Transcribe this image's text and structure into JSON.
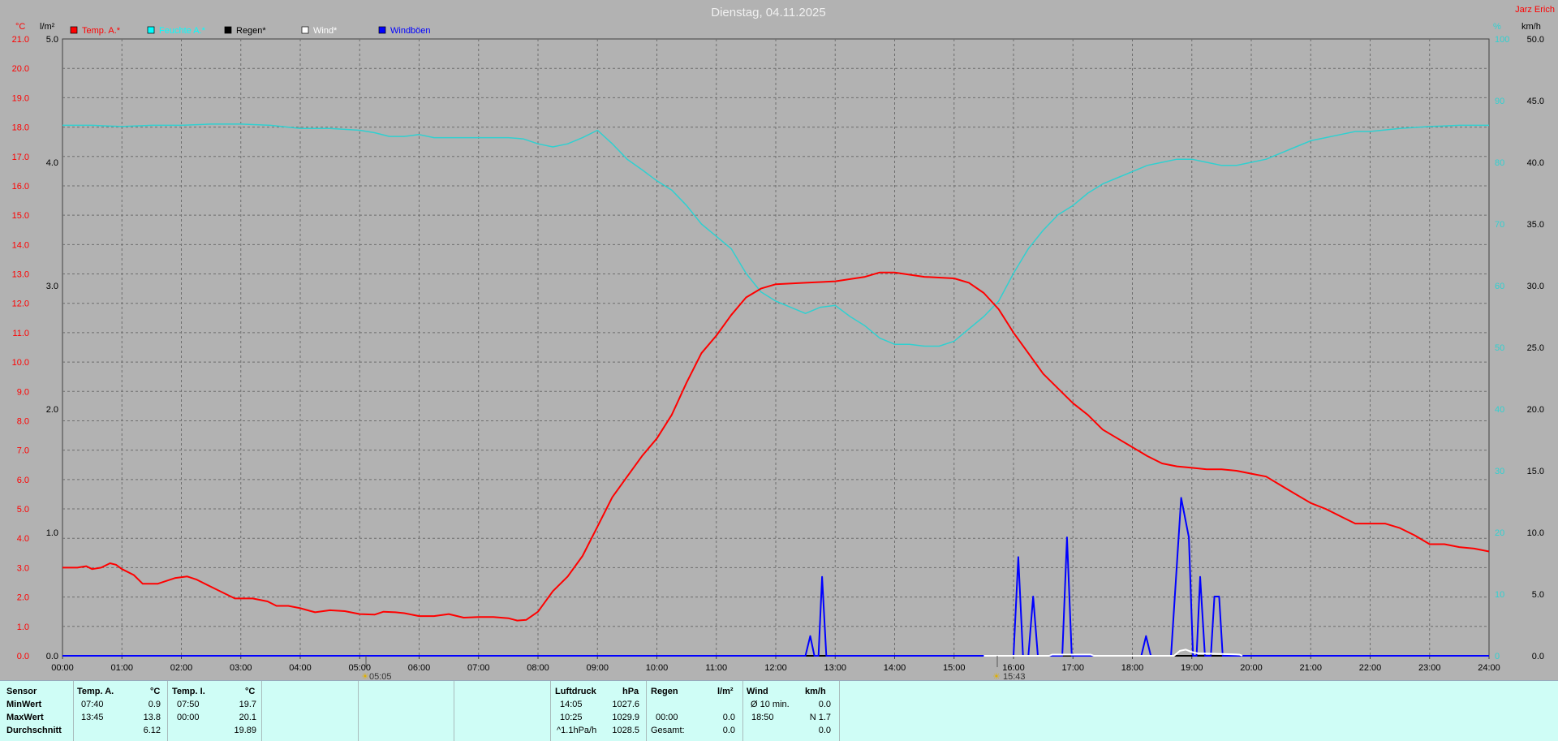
{
  "title": "Dienstag, 04.11.2025",
  "author": "Jarz Erich",
  "units": {
    "temp": "°C",
    "rain": "l/m²",
    "hum": "%",
    "wind": "km/h"
  },
  "legend": [
    {
      "label": "Temp. A.*",
      "color": "#ff0000"
    },
    {
      "label": "Feuchte A.*",
      "color": "#00ffff"
    },
    {
      "label": "Regen*",
      "color": "#000000"
    },
    {
      "label": "Wind*",
      "color": "#ffffff"
    },
    {
      "label": "Windböen",
      "color": "#0000ff"
    }
  ],
  "sun": {
    "rise": "05:05",
    "set": "15:43"
  },
  "chart_data": {
    "type": "line",
    "x_ticks": [
      "00:00",
      "01:00",
      "02:00",
      "03:00",
      "04:00",
      "05:00",
      "06:00",
      "07:00",
      "08:00",
      "09:00",
      "10:00",
      "11:00",
      "12:00",
      "13:00",
      "14:00",
      "15:00",
      "16:00",
      "17:00",
      "18:00",
      "19:00",
      "20:00",
      "21:00",
      "22:00",
      "23:00",
      "24:00"
    ],
    "temp_ticks": [
      "0.0",
      "1.0",
      "2.0",
      "3.0",
      "4.0",
      "5.0",
      "6.0",
      "7.0",
      "8.0",
      "9.0",
      "10.0",
      "11.0",
      "12.0",
      "13.0",
      "14.0",
      "15.0",
      "16.0",
      "17.0",
      "18.0",
      "19.0",
      "20.0",
      "21.0"
    ],
    "rain_ticks": [
      "0.0",
      "1.0",
      "2.0",
      "3.0",
      "4.0",
      "5.0"
    ],
    "hum_ticks": [
      "0",
      "10",
      "20",
      "30",
      "40",
      "50",
      "60",
      "70",
      "80",
      "90",
      "100"
    ],
    "wind_ticks": [
      "0.0",
      "5.0",
      "10.0",
      "15.0",
      "20.0",
      "25.0",
      "30.0",
      "35.0",
      "40.0",
      "45.0",
      "50.0"
    ],
    "ylim_temp": [
      0,
      21
    ],
    "ylim_rain": [
      0,
      5
    ],
    "ylim_hum": [
      0,
      100
    ],
    "ylim_wind": [
      0,
      50
    ],
    "grid": true,
    "series": [
      {
        "name": "Temp. A.*",
        "color": "#ff0000",
        "axis": "temp",
        "points": [
          [
            0,
            3.0
          ],
          [
            0.25,
            3.0
          ],
          [
            0.4,
            3.05
          ],
          [
            0.5,
            2.95
          ],
          [
            0.65,
            3.0
          ],
          [
            0.8,
            3.15
          ],
          [
            0.9,
            3.1
          ],
          [
            1.0,
            2.95
          ],
          [
            1.2,
            2.75
          ],
          [
            1.35,
            2.45
          ],
          [
            1.6,
            2.45
          ],
          [
            1.75,
            2.55
          ],
          [
            1.9,
            2.65
          ],
          [
            2.1,
            2.7
          ],
          [
            2.25,
            2.6
          ],
          [
            2.5,
            2.35
          ],
          [
            2.75,
            2.1
          ],
          [
            2.9,
            1.95
          ],
          [
            3.2,
            1.95
          ],
          [
            3.45,
            1.85
          ],
          [
            3.6,
            1.7
          ],
          [
            3.8,
            1.7
          ],
          [
            4.0,
            1.62
          ],
          [
            4.25,
            1.48
          ],
          [
            4.5,
            1.55
          ],
          [
            4.75,
            1.52
          ],
          [
            5.0,
            1.42
          ],
          [
            5.25,
            1.4
          ],
          [
            5.4,
            1.5
          ],
          [
            5.6,
            1.48
          ],
          [
            5.75,
            1.45
          ],
          [
            6.0,
            1.35
          ],
          [
            6.25,
            1.35
          ],
          [
            6.5,
            1.42
          ],
          [
            6.75,
            1.3
          ],
          [
            7.0,
            1.32
          ],
          [
            7.25,
            1.32
          ],
          [
            7.5,
            1.28
          ],
          [
            7.65,
            1.2
          ],
          [
            7.8,
            1.22
          ],
          [
            8.0,
            1.5
          ],
          [
            8.25,
            2.2
          ],
          [
            8.5,
            2.7
          ],
          [
            8.75,
            3.4
          ],
          [
            9.0,
            4.4
          ],
          [
            9.25,
            5.4
          ],
          [
            9.5,
            6.1
          ],
          [
            9.75,
            6.8
          ],
          [
            10.0,
            7.4
          ],
          [
            10.25,
            8.2
          ],
          [
            10.5,
            9.3
          ],
          [
            10.75,
            10.3
          ],
          [
            11.0,
            10.9
          ],
          [
            11.25,
            11.6
          ],
          [
            11.5,
            12.2
          ],
          [
            11.75,
            12.5
          ],
          [
            12.0,
            12.65
          ],
          [
            12.5,
            12.7
          ],
          [
            13.0,
            12.75
          ],
          [
            13.5,
            12.9
          ],
          [
            13.75,
            13.05
          ],
          [
            14.0,
            13.05
          ],
          [
            14.5,
            12.9
          ],
          [
            15.0,
            12.85
          ],
          [
            15.25,
            12.7
          ],
          [
            15.5,
            12.35
          ],
          [
            15.75,
            11.8
          ],
          [
            16.0,
            11.0
          ],
          [
            16.25,
            10.3
          ],
          [
            16.5,
            9.6
          ],
          [
            16.75,
            9.1
          ],
          [
            17.0,
            8.6
          ],
          [
            17.25,
            8.2
          ],
          [
            17.5,
            7.7
          ],
          [
            17.75,
            7.4
          ],
          [
            18.0,
            7.1
          ],
          [
            18.25,
            6.8
          ],
          [
            18.5,
            6.55
          ],
          [
            18.75,
            6.45
          ],
          [
            19.0,
            6.4
          ],
          [
            19.25,
            6.35
          ],
          [
            19.5,
            6.35
          ],
          [
            19.75,
            6.3
          ],
          [
            20.0,
            6.2
          ],
          [
            20.25,
            6.1
          ],
          [
            20.5,
            5.8
          ],
          [
            20.75,
            5.5
          ],
          [
            21.0,
            5.2
          ],
          [
            21.25,
            5.0
          ],
          [
            21.5,
            4.75
          ],
          [
            21.75,
            4.5
          ],
          [
            22.0,
            4.5
          ],
          [
            22.25,
            4.5
          ],
          [
            22.5,
            4.35
          ],
          [
            22.75,
            4.1
          ],
          [
            23.0,
            3.8
          ],
          [
            23.25,
            3.8
          ],
          [
            23.5,
            3.7
          ],
          [
            23.75,
            3.65
          ],
          [
            24.0,
            3.55
          ]
        ]
      },
      {
        "name": "Feuchte A.*",
        "color": "#30d0d0",
        "axis": "hum",
        "points": [
          [
            0,
            86.0
          ],
          [
            0.5,
            86.0
          ],
          [
            1.0,
            85.8
          ],
          [
            1.5,
            86.0
          ],
          [
            2.0,
            86.0
          ],
          [
            2.5,
            86.2
          ],
          [
            3.0,
            86.2
          ],
          [
            3.5,
            86.0
          ],
          [
            4.0,
            85.5
          ],
          [
            4.5,
            85.5
          ],
          [
            5.0,
            85.2
          ],
          [
            5.25,
            84.8
          ],
          [
            5.5,
            84.2
          ],
          [
            5.75,
            84.2
          ],
          [
            6.0,
            84.5
          ],
          [
            6.25,
            84.0
          ],
          [
            6.5,
            84.0
          ],
          [
            6.75,
            84.0
          ],
          [
            7.0,
            84.0
          ],
          [
            7.5,
            84.0
          ],
          [
            7.75,
            83.8
          ],
          [
            8.0,
            83.0
          ],
          [
            8.25,
            82.5
          ],
          [
            8.5,
            83.0
          ],
          [
            8.75,
            84.0
          ],
          [
            9.0,
            85.2
          ],
          [
            9.25,
            83.0
          ],
          [
            9.5,
            80.5
          ],
          [
            9.75,
            78.8
          ],
          [
            10.0,
            77.0
          ],
          [
            10.25,
            75.5
          ],
          [
            10.5,
            73.0
          ],
          [
            10.75,
            70.0
          ],
          [
            11.0,
            68.0
          ],
          [
            11.25,
            66.0
          ],
          [
            11.5,
            62.0
          ],
          [
            11.75,
            59.0
          ],
          [
            12.0,
            57.5
          ],
          [
            12.25,
            56.5
          ],
          [
            12.5,
            55.5
          ],
          [
            12.75,
            56.5
          ],
          [
            13.0,
            56.8
          ],
          [
            13.25,
            55.0
          ],
          [
            13.5,
            53.5
          ],
          [
            13.75,
            51.5
          ],
          [
            14.0,
            50.5
          ],
          [
            14.25,
            50.5
          ],
          [
            14.5,
            50.2
          ],
          [
            14.75,
            50.2
          ],
          [
            15.0,
            51.0
          ],
          [
            15.25,
            53.0
          ],
          [
            15.5,
            55.0
          ],
          [
            15.75,
            57.5
          ],
          [
            16.0,
            62.0
          ],
          [
            16.25,
            66.0
          ],
          [
            16.5,
            69.0
          ],
          [
            16.75,
            71.5
          ],
          [
            17.0,
            73.0
          ],
          [
            17.25,
            75.0
          ],
          [
            17.5,
            76.5
          ],
          [
            17.75,
            77.5
          ],
          [
            18.0,
            78.5
          ],
          [
            18.25,
            79.5
          ],
          [
            18.5,
            80.0
          ],
          [
            18.75,
            80.5
          ],
          [
            19.0,
            80.5
          ],
          [
            19.25,
            80.0
          ],
          [
            19.5,
            79.5
          ],
          [
            19.75,
            79.5
          ],
          [
            20.0,
            80.0
          ],
          [
            20.25,
            80.5
          ],
          [
            20.5,
            81.5
          ],
          [
            20.75,
            82.5
          ],
          [
            21.0,
            83.5
          ],
          [
            21.25,
            84.0
          ],
          [
            21.5,
            84.5
          ],
          [
            21.75,
            85.0
          ],
          [
            22.0,
            85.0
          ],
          [
            22.5,
            85.5
          ],
          [
            23.0,
            85.8
          ],
          [
            23.5,
            86.0
          ],
          [
            24.0,
            86.0
          ]
        ]
      },
      {
        "name": "Regen*",
        "color": "#000000",
        "axis": "rain",
        "points": [
          [
            0,
            0
          ],
          [
            24,
            0
          ]
        ]
      },
      {
        "name": "Wind*",
        "color": "#ffffff",
        "axis": "wind",
        "points": [
          [
            15.5,
            0
          ],
          [
            16.6,
            0
          ],
          [
            16.65,
            0.1
          ],
          [
            17.3,
            0.1
          ],
          [
            17.35,
            0
          ],
          [
            18.7,
            0
          ],
          [
            18.8,
            0.4
          ],
          [
            18.9,
            0.5
          ],
          [
            19.0,
            0.3
          ],
          [
            19.1,
            0.2
          ],
          [
            19.5,
            0.15
          ],
          [
            19.8,
            0.1
          ],
          [
            19.85,
            0
          ]
        ]
      },
      {
        "name": "Windböen",
        "color": "#0000ff",
        "axis": "wind",
        "points": [
          [
            0,
            0
          ],
          [
            12.5,
            0
          ],
          [
            12.58,
            1.6
          ],
          [
            12.65,
            0
          ],
          [
            12.72,
            0
          ],
          [
            12.78,
            6.4
          ],
          [
            12.85,
            0
          ],
          [
            16.0,
            0
          ],
          [
            16.08,
            8.0
          ],
          [
            16.16,
            0
          ],
          [
            16.25,
            0
          ],
          [
            16.33,
            4.8
          ],
          [
            16.41,
            0
          ],
          [
            16.82,
            0
          ],
          [
            16.9,
            9.6
          ],
          [
            16.98,
            0
          ],
          [
            18.15,
            0
          ],
          [
            18.23,
            1.6
          ],
          [
            18.31,
            0
          ],
          [
            18.65,
            0
          ],
          [
            18.82,
            12.8
          ],
          [
            18.95,
            9.6
          ],
          [
            19.02,
            0
          ],
          [
            19.08,
            0
          ],
          [
            19.14,
            6.4
          ],
          [
            19.22,
            0
          ],
          [
            19.32,
            0
          ],
          [
            19.38,
            4.8
          ],
          [
            19.46,
            4.8
          ],
          [
            19.52,
            0
          ],
          [
            24,
            0
          ]
        ]
      }
    ]
  },
  "panel": {
    "headers": {
      "sensor": "Sensor",
      "temp_a": "Temp. A.",
      "temp_a_unit": "°C",
      "temp_i": "Temp. I.",
      "temp_i_unit": "°C",
      "pressure": "Luftdruck",
      "pressure_unit": "hPa",
      "rain": "Regen",
      "rain_unit": "l/m²",
      "wind": "Wind",
      "wind_unit": "km/h"
    },
    "rows": {
      "min": {
        "label": "MinWert",
        "ta_time": "07:40",
        "ta_val": "0.9",
        "ti_time": "07:50",
        "ti_val": "19.7",
        "p_time": "14:05",
        "p_val": "1027.6",
        "w_label": "Ø 10 min.",
        "w_val": "0.0"
      },
      "max": {
        "label": "MaxWert",
        "ta_time": "13:45",
        "ta_val": "13.8",
        "ti_time": "00:00",
        "ti_val": "20.1",
        "p_time": "10:25",
        "p_val": "1029.9",
        "r_time": "00:00",
        "r_val": "0.0",
        "w_time": "18:50",
        "w_val": "N 1.7"
      },
      "avg": {
        "label": "Durchschnitt",
        "ta_val": "6.12",
        "ti_val": "19.89",
        "p_time": "^1.1hPa/h",
        "p_val": "1028.5",
        "r_label": "Gesamt:",
        "r_val": "0.0",
        "w_val": "0.0"
      }
    }
  }
}
